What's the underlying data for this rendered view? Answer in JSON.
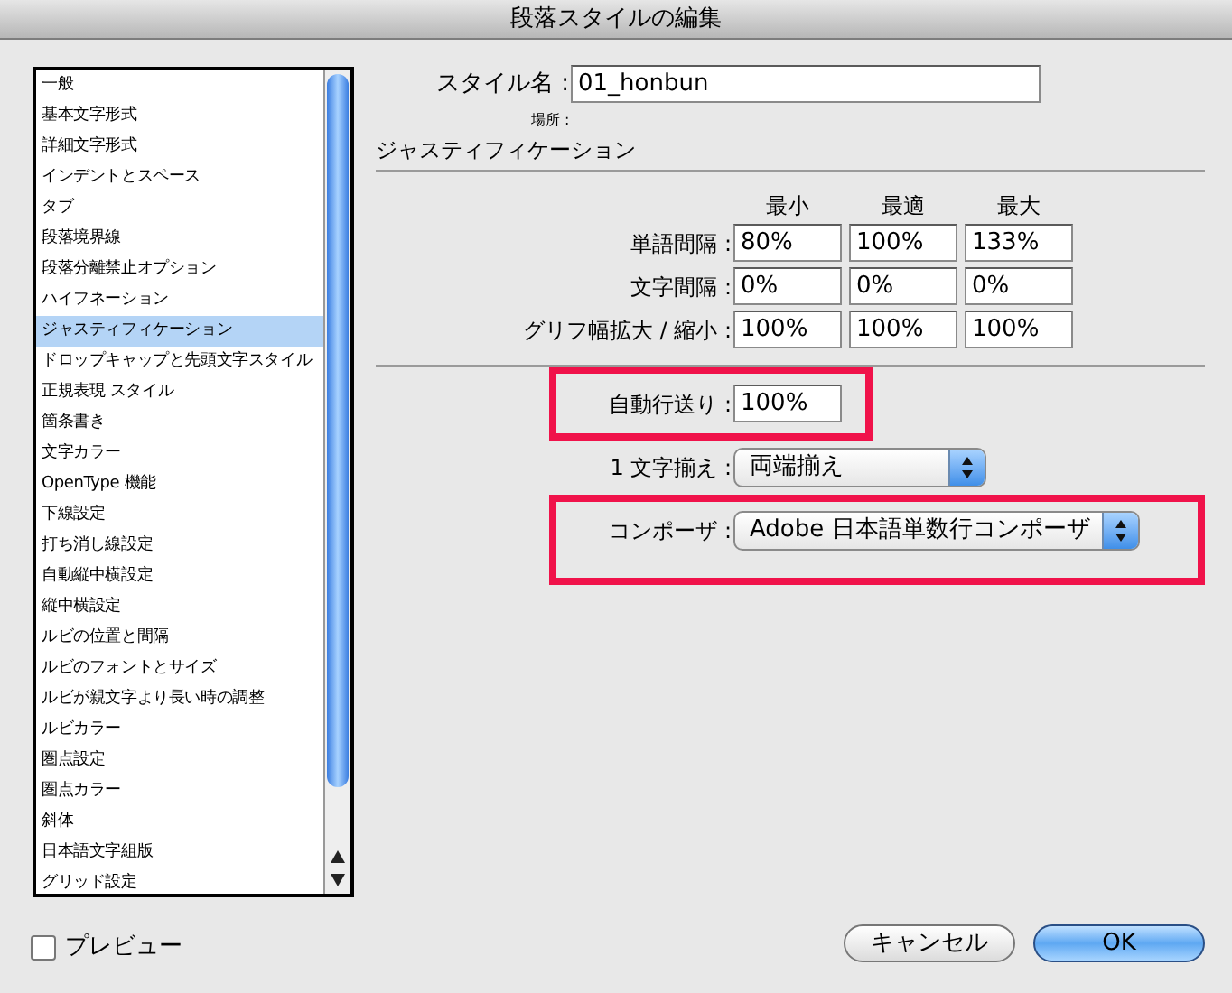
{
  "window": {
    "title": "段落スタイルの編集"
  },
  "sidebar": {
    "items": [
      {
        "label": "一般",
        "selected": false
      },
      {
        "label": "基本文字形式",
        "selected": false
      },
      {
        "label": "詳細文字形式",
        "selected": false
      },
      {
        "label": "インデントとスペース",
        "selected": false
      },
      {
        "label": "タブ",
        "selected": false
      },
      {
        "label": "段落境界線",
        "selected": false
      },
      {
        "label": "段落分離禁止オプション",
        "selected": false
      },
      {
        "label": "ハイフネーション",
        "selected": false
      },
      {
        "label": "ジャスティフィケーション",
        "selected": true
      },
      {
        "label": "ドロップキャップと先頭文字スタイル",
        "selected": false
      },
      {
        "label": "正規表現 スタイル",
        "selected": false
      },
      {
        "label": "箇条書き",
        "selected": false
      },
      {
        "label": "文字カラー",
        "selected": false
      },
      {
        "label": "OpenType 機能",
        "selected": false
      },
      {
        "label": "下線設定",
        "selected": false
      },
      {
        "label": "打ち消し線設定",
        "selected": false
      },
      {
        "label": "自動縦中横設定",
        "selected": false
      },
      {
        "label": "縦中横設定",
        "selected": false
      },
      {
        "label": "ルビの位置と間隔",
        "selected": false
      },
      {
        "label": "ルビのフォントとサイズ",
        "selected": false
      },
      {
        "label": "ルビが親文字より長い時の調整",
        "selected": false
      },
      {
        "label": "ルビカラー",
        "selected": false
      },
      {
        "label": "圏点設定",
        "selected": false
      },
      {
        "label": "圏点カラー",
        "selected": false
      },
      {
        "label": "斜体",
        "selected": false
      },
      {
        "label": "日本語文字組版",
        "selected": false
      },
      {
        "label": "グリッド設定",
        "selected": false
      }
    ]
  },
  "style_name": {
    "label": "スタイル名 :",
    "value": "01_honbun"
  },
  "location": {
    "label": "場所 :"
  },
  "section": {
    "title": "ジャスティフィケーション",
    "columns": [
      "最小",
      "最適",
      "最大"
    ],
    "rows": [
      {
        "label": "単語間隔 :",
        "values": [
          "80%",
          "100%",
          "133%"
        ]
      },
      {
        "label": "文字間隔 :",
        "values": [
          "0%",
          "0%",
          "0%"
        ]
      },
      {
        "label": "グリフ幅拡大 / 縮小 :",
        "values": [
          "100%",
          "100%",
          "100%"
        ]
      }
    ]
  },
  "options": [
    {
      "kind": "input",
      "label": "自動行送り :",
      "value": "100%",
      "highlighted": true
    },
    {
      "kind": "select",
      "label": "1 文字揃え :",
      "value": "両端揃え",
      "highlighted": false
    },
    {
      "kind": "select",
      "label": "コンポーザ :",
      "value": "Adobe 日本語単数行コンポーザ",
      "highlighted": true
    }
  ],
  "preview": {
    "label": "プレビュー",
    "checked": false
  },
  "buttons": [
    {
      "label": "キャンセル",
      "kind": "default"
    },
    {
      "label": "OK",
      "kind": "primary"
    }
  ]
}
